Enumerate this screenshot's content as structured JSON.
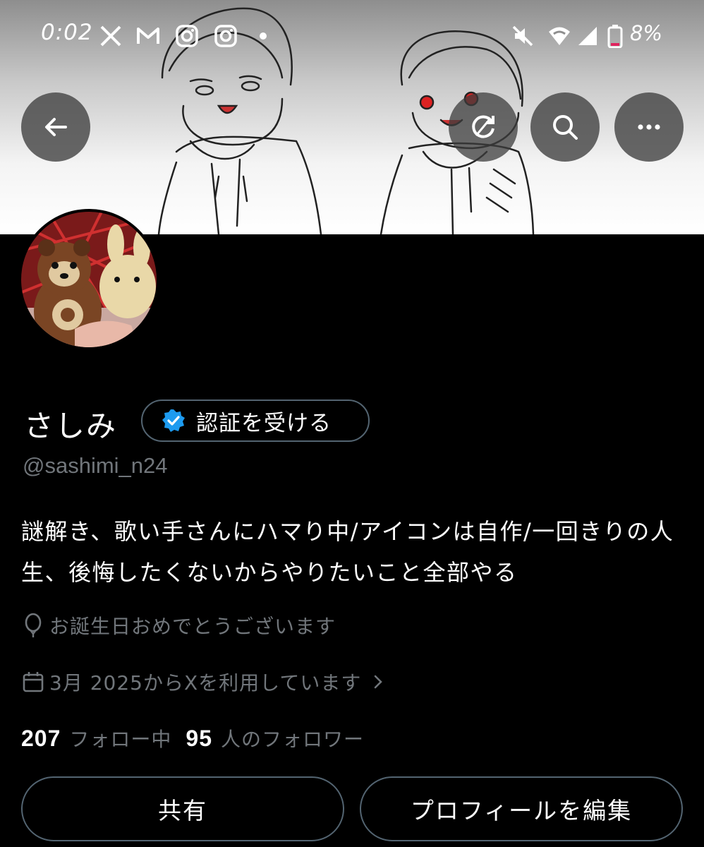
{
  "status_bar": {
    "time": "0:02",
    "battery_text": "8%",
    "icons": [
      "x-logo-icon",
      "gmail-icon",
      "instagram-icon",
      "instagram-icon",
      "dot-icon",
      "mute-icon",
      "wifi-icon",
      "signal-icon",
      "battery-icon"
    ]
  },
  "nav": {
    "back_icon": "arrow-left-icon",
    "search_icon": "search-icon",
    "more_icon": "more-horizontal-icon",
    "sync_icon": "sync-icon"
  },
  "profile": {
    "display_name": "さしみ",
    "verify_button_label": "認証を受ける",
    "handle": "@sashimi_n24",
    "bio": "謎解き、歌い手さんにハマり中/アイコンは自作/一回きりの人生、後悔したくないからやりたいこと全部やる",
    "birthday_text": "お誕生日おめでとうございます",
    "joined_text": "3月 2025からXを利用しています",
    "following_count": "207",
    "following_label": "フォロー中",
    "followers_count": "95",
    "followers_label": "人のフォロワー"
  },
  "actions": {
    "share_label": "共有",
    "edit_profile_label": "プロフィールを編集"
  },
  "colors": {
    "background": "#000000",
    "text_primary": "#ffffff",
    "text_secondary": "#71767b",
    "border": "#536471",
    "verified_blue": "#1d9bf0"
  }
}
